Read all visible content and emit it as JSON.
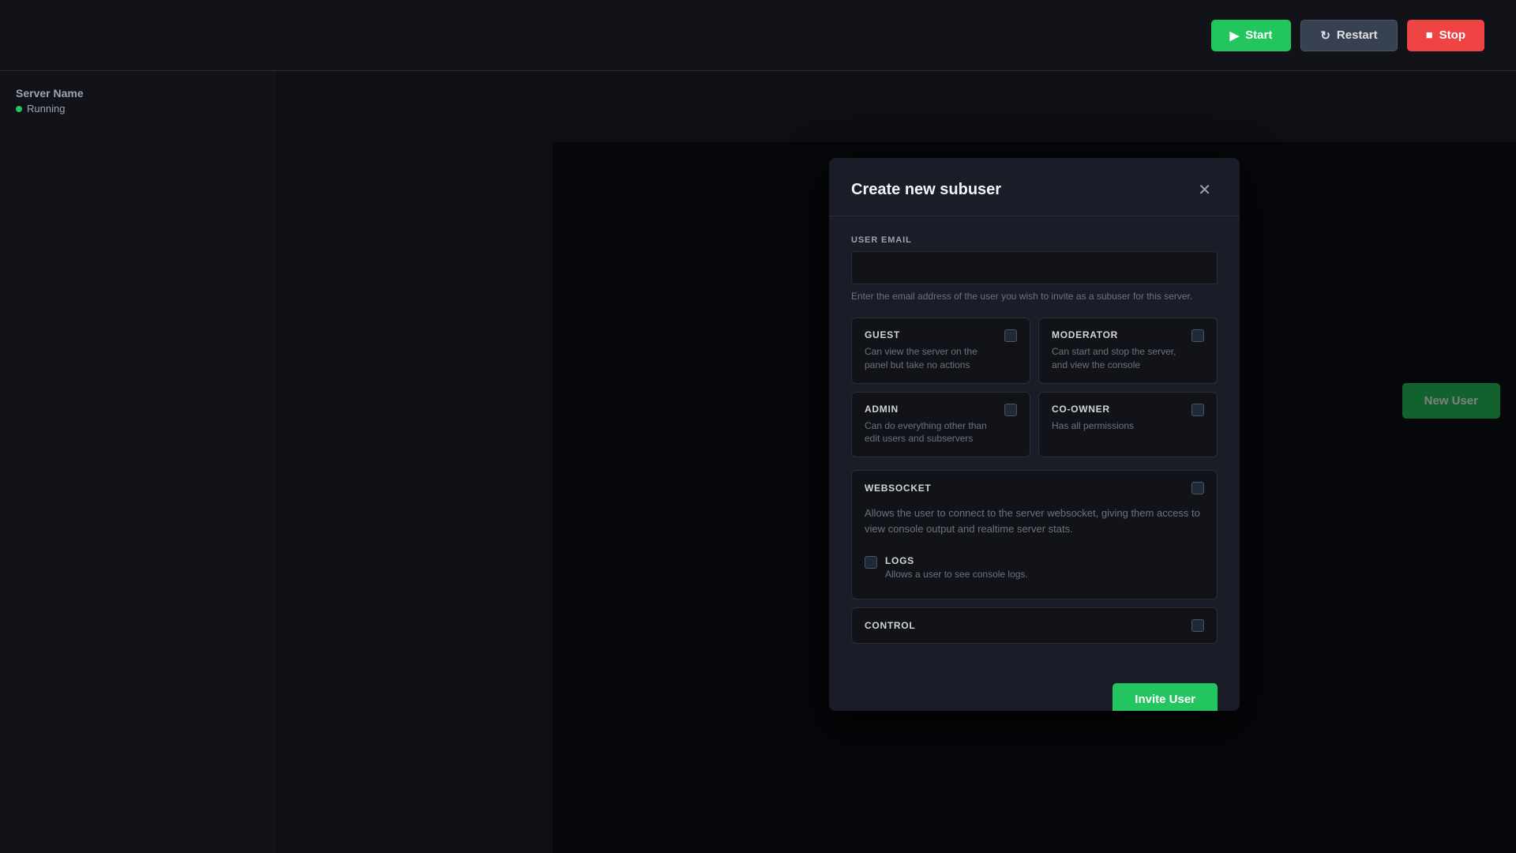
{
  "topbar": {
    "start_label": "Start",
    "restart_label": "Restart",
    "stop_label": "Stop"
  },
  "sidebar": {
    "server_name": "Server Name",
    "status": "Running"
  },
  "main": {
    "new_user_label": "New User"
  },
  "modal": {
    "title": "Create new subuser",
    "email_label": "USER EMAIL",
    "email_placeholder": "",
    "email_hint": "Enter the email address of the user you wish to invite as a subuser for this server.",
    "roles": [
      {
        "name": "GUEST",
        "desc": "Can view the server on the panel but take no actions"
      },
      {
        "name": "MODERATOR",
        "desc": "Can start and stop the server, and view the console"
      },
      {
        "name": "ADMIN",
        "desc": "Can do everything other than edit users and subservers"
      },
      {
        "name": "CO-OWNER",
        "desc": "Has all permissions"
      }
    ],
    "permissions": [
      {
        "name": "WEBSOCKET",
        "desc": "Allows the user to connect to the server websocket, giving them access to view console output and realtime server stats.",
        "sub_permissions": [
          {
            "name": "LOGS",
            "desc": "Allows a user to see console logs."
          }
        ]
      },
      {
        "name": "CONTROL",
        "desc": "",
        "sub_permissions": []
      }
    ],
    "invite_button": "Invite User"
  }
}
